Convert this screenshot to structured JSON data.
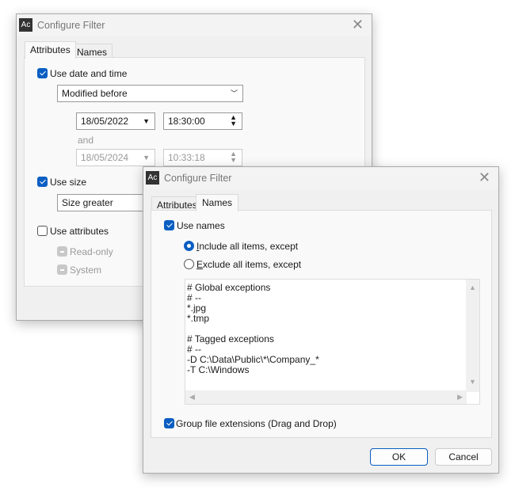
{
  "dialog1": {
    "title": "Configure Filter",
    "app_icon": "Ac",
    "tabs": [
      {
        "label": "Attributes",
        "selected": true
      },
      {
        "label": "Names",
        "selected": false
      }
    ],
    "use_date_time": {
      "label": "Use date and time",
      "checked": true
    },
    "date_mode": "Modified before",
    "date_from": "18/05/2022",
    "time_from": "18:30:00",
    "and_label": "and",
    "date_to": "18/05/2024",
    "time_to": "10:33:18",
    "use_size": {
      "label": "Use size",
      "checked": true
    },
    "size_mode": "Size greater",
    "use_attributes": {
      "label": "Use attributes",
      "checked": false
    },
    "read_only": "Read-only",
    "system": "System"
  },
  "dialog2": {
    "title": "Configure Filter",
    "app_icon": "Ac",
    "tabs": [
      {
        "label": "Attributes",
        "selected": false
      },
      {
        "label": "Names",
        "selected": true
      }
    ],
    "use_names": {
      "label": "Use names",
      "checked": true
    },
    "include": {
      "first": "I",
      "rest": "nclude all items, except",
      "selected": true
    },
    "exclude": {
      "first": "E",
      "rest": "xclude all items, except",
      "selected": false
    },
    "text": "# Global exceptions\n# --\n*.jpg\n*.tmp\n\n# Tagged exceptions\n# --\n-D C:\\Data\\Public\\*\\Company_*\n-T C:\\Windows",
    "group_ext": {
      "label": "Group file extensions (Drag and Drop)",
      "checked": true
    },
    "ok": "OK",
    "cancel": "Cancel"
  },
  "colors": {
    "accent": "#0a5ec2"
  }
}
